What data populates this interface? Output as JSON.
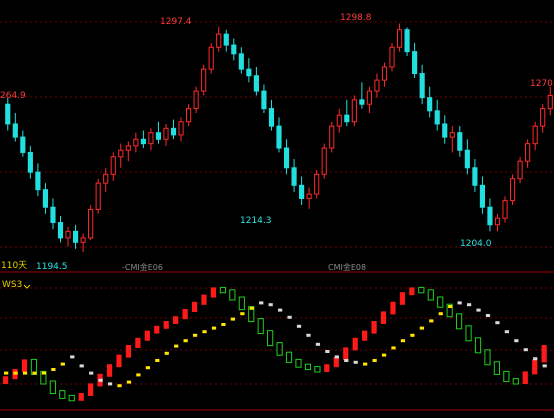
{
  "colors": {
    "up": "#ff2a2a",
    "down": "#22e0e0",
    "grid": "#7a0000",
    "axis": "#a00000",
    "text_red": "#ff3b3b",
    "text_cyan": "#2ee6e6",
    "text_yellow": "#e6d200",
    "ind_red": "#ff1a1a",
    "ind_green": "#1fd01f",
    "ind_yellow": "#ffe600",
    "ind_white": "#d8d8d8"
  },
  "price_labels": {
    "left_high": "264.9",
    "high1": "1297.4",
    "high2": "1298.8",
    "right_high": "1270.",
    "low1": "1194.5",
    "low2": "1214.3",
    "low3": "1204.0"
  },
  "axis": {
    "period": "110天",
    "date1": "-CMI金E06",
    "date2": "CMI金E08"
  },
  "indicator": {
    "name": "WS3",
    "dropdown_icon": "chevron-down-icon"
  },
  "chart_data": {
    "type": "candlestick",
    "price_range": [
      1190,
      1305
    ],
    "candles_ohlc": [
      [
        1262,
        1264.9,
        1250,
        1253
      ],
      [
        1253,
        1258,
        1245,
        1247
      ],
      [
        1247,
        1250,
        1238,
        1240
      ],
      [
        1240,
        1243,
        1228,
        1231
      ],
      [
        1231,
        1235,
        1220,
        1223
      ],
      [
        1223,
        1226,
        1212,
        1215
      ],
      [
        1215,
        1219,
        1205,
        1208
      ],
      [
        1208,
        1211,
        1199,
        1201
      ],
      [
        1201,
        1206,
        1197,
        1204
      ],
      [
        1204,
        1207,
        1196,
        1199
      ],
      [
        1199,
        1203,
        1194.5,
        1201
      ],
      [
        1201,
        1216,
        1200,
        1214
      ],
      [
        1214,
        1228,
        1212,
        1226
      ],
      [
        1226,
        1233,
        1222,
        1230
      ],
      [
        1230,
        1240,
        1227,
        1238
      ],
      [
        1238,
        1244,
        1233,
        1241
      ],
      [
        1241,
        1245,
        1236,
        1243
      ],
      [
        1243,
        1249,
        1240,
        1246
      ],
      [
        1246,
        1250,
        1242,
        1244
      ],
      [
        1244,
        1251,
        1241,
        1249
      ],
      [
        1249,
        1254,
        1244,
        1246
      ],
      [
        1246,
        1253,
        1243,
        1251
      ],
      [
        1251,
        1255,
        1246,
        1248
      ],
      [
        1248,
        1256,
        1245,
        1254
      ],
      [
        1254,
        1262,
        1252,
        1260
      ],
      [
        1260,
        1270,
        1258,
        1268
      ],
      [
        1268,
        1280,
        1266,
        1278
      ],
      [
        1278,
        1290,
        1276,
        1288
      ],
      [
        1288,
        1297.4,
        1286,
        1294
      ],
      [
        1294,
        1296,
        1286,
        1289
      ],
      [
        1289,
        1292,
        1282,
        1285
      ],
      [
        1285,
        1288,
        1276,
        1278
      ],
      [
        1278,
        1283,
        1272,
        1275
      ],
      [
        1275,
        1279,
        1266,
        1268
      ],
      [
        1268,
        1271,
        1258,
        1260
      ],
      [
        1260,
        1264,
        1250,
        1252
      ],
      [
        1252,
        1256,
        1240,
        1242
      ],
      [
        1242,
        1246,
        1230,
        1233
      ],
      [
        1233,
        1237,
        1222,
        1225
      ],
      [
        1225,
        1229,
        1216,
        1219
      ],
      [
        1219,
        1224,
        1214.3,
        1221
      ],
      [
        1221,
        1232,
        1219,
        1230
      ],
      [
        1230,
        1244,
        1228,
        1242
      ],
      [
        1242,
        1254,
        1240,
        1252
      ],
      [
        1252,
        1260,
        1249,
        1257
      ],
      [
        1257,
        1264,
        1252,
        1254
      ],
      [
        1254,
        1266,
        1252,
        1264
      ],
      [
        1264,
        1272,
        1260,
        1262
      ],
      [
        1262,
        1270,
        1258,
        1268
      ],
      [
        1268,
        1276,
        1265,
        1273
      ],
      [
        1273,
        1281,
        1270,
        1279
      ],
      [
        1279,
        1290,
        1277,
        1288
      ],
      [
        1288,
        1298.8,
        1286,
        1296
      ],
      [
        1296,
        1297,
        1284,
        1286
      ],
      [
        1286,
        1290,
        1274,
        1276
      ],
      [
        1276,
        1280,
        1262,
        1265
      ],
      [
        1265,
        1270,
        1256,
        1259
      ],
      [
        1259,
        1264,
        1250,
        1253
      ],
      [
        1253,
        1257,
        1244,
        1247
      ],
      [
        1247,
        1252,
        1240,
        1249
      ],
      [
        1249,
        1252,
        1238,
        1241
      ],
      [
        1241,
        1246,
        1230,
        1233
      ],
      [
        1233,
        1237,
        1222,
        1225
      ],
      [
        1225,
        1229,
        1212,
        1215
      ],
      [
        1215,
        1219,
        1204,
        1207
      ],
      [
        1207,
        1212,
        1204.0,
        1210
      ],
      [
        1210,
        1220,
        1208,
        1218
      ],
      [
        1218,
        1230,
        1216,
        1228
      ],
      [
        1228,
        1238,
        1226,
        1236
      ],
      [
        1236,
        1246,
        1233,
        1244
      ],
      [
        1244,
        1254,
        1241,
        1252
      ],
      [
        1252,
        1262,
        1249,
        1260
      ],
      [
        1260,
        1270,
        1257,
        1266
      ]
    ],
    "indicator_band": [
      0.2,
      0.24,
      0.3,
      0.38,
      0.28,
      0.2,
      0.12,
      0.08,
      0.06,
      0.1,
      0.18,
      0.26,
      0.34,
      0.42,
      0.5,
      0.56,
      0.62,
      0.66,
      0.7,
      0.74,
      0.8,
      0.86,
      0.92,
      0.98,
      0.96,
      0.9,
      0.82,
      0.72,
      0.62,
      0.52,
      0.44,
      0.38,
      0.34,
      0.32,
      0.3,
      0.34,
      0.4,
      0.48,
      0.56,
      0.62,
      0.7,
      0.78,
      0.86,
      0.94,
      0.98,
      0.96,
      0.9,
      0.84,
      0.76,
      0.66,
      0.56,
      0.46,
      0.36,
      0.28,
      0.22,
      0.2,
      0.28,
      0.38,
      0.5
    ]
  }
}
